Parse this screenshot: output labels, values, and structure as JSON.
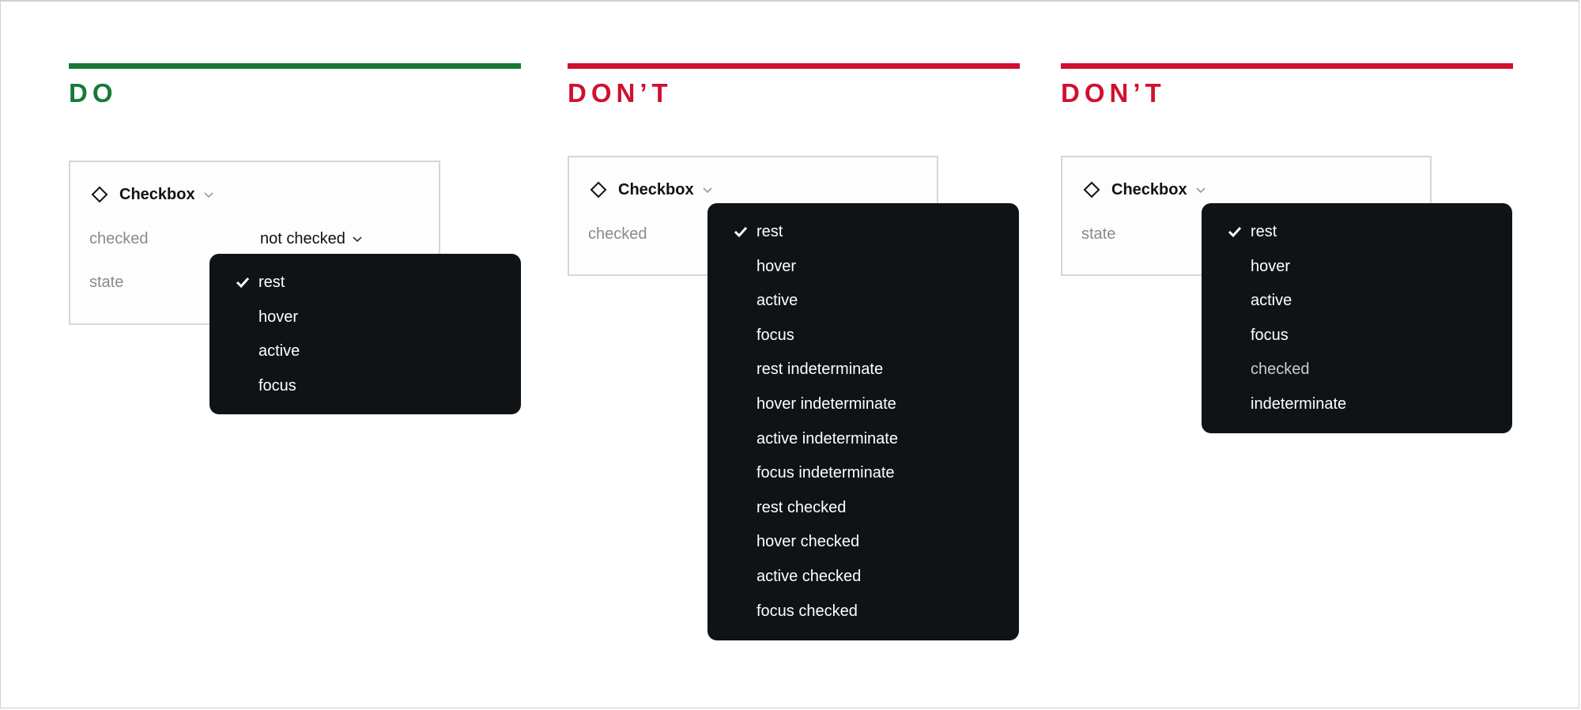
{
  "colors": {
    "do": "#157a35",
    "dont": "#d0102f",
    "menu_bg": "#101316"
  },
  "columns": [
    {
      "heading": "DO",
      "component": {
        "icon": "diamond-icon",
        "name": "Checkbox"
      },
      "props": [
        {
          "label": "checked",
          "value": "not checked"
        },
        {
          "label": "state"
        }
      ],
      "menu": [
        {
          "label": "rest",
          "selected": true
        },
        {
          "label": "hover"
        },
        {
          "label": "active"
        },
        {
          "label": "focus"
        }
      ]
    },
    {
      "heading": "DON’T",
      "component": {
        "icon": "diamond-icon",
        "name": "Checkbox"
      },
      "props": [
        {
          "label": "checked"
        }
      ],
      "menu": [
        {
          "label": "rest",
          "selected": true
        },
        {
          "label": "hover"
        },
        {
          "label": "active"
        },
        {
          "label": "focus"
        },
        {
          "label": "rest indeterminate"
        },
        {
          "label": "hover indeterminate"
        },
        {
          "label": "active indeterminate"
        },
        {
          "label": "focus indeterminate"
        },
        {
          "label": "rest checked"
        },
        {
          "label": "hover checked"
        },
        {
          "label": "active checked"
        },
        {
          "label": "focus checked"
        }
      ]
    },
    {
      "heading": "DON’T",
      "component": {
        "icon": "diamond-icon",
        "name": "Checkbox"
      },
      "props": [
        {
          "label": "state"
        }
      ],
      "menu": [
        {
          "label": "rest",
          "selected": true
        },
        {
          "label": "hover"
        },
        {
          "label": "active"
        },
        {
          "label": "focus"
        },
        {
          "label": "checked"
        },
        {
          "label": "indeterminate"
        }
      ]
    }
  ]
}
